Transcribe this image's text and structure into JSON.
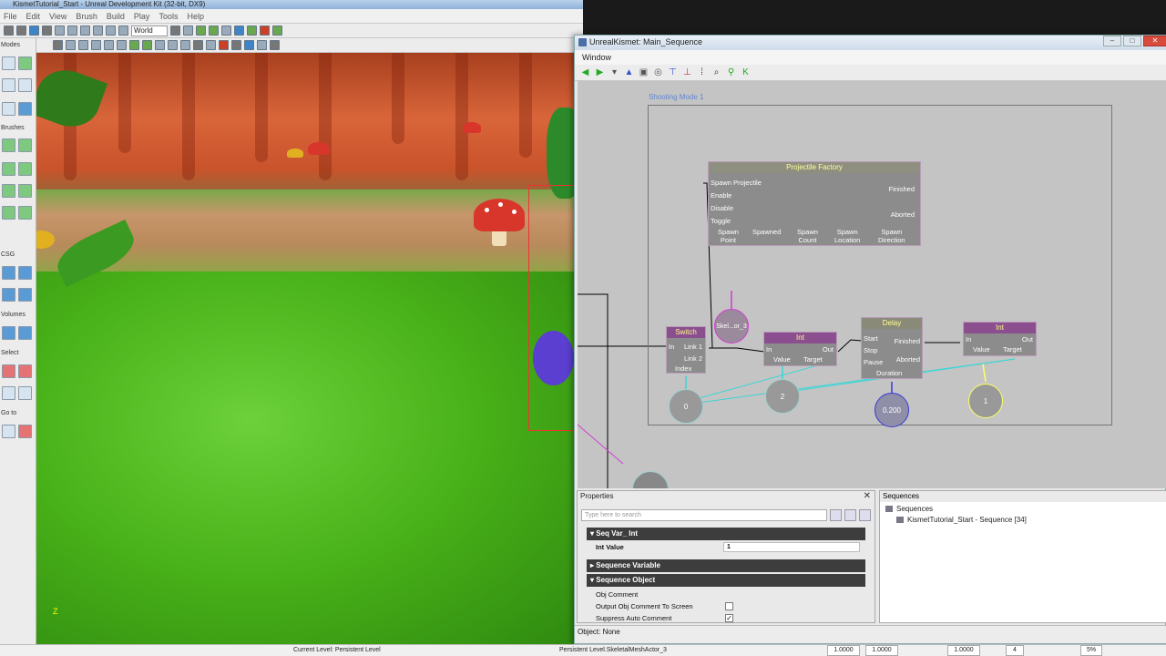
{
  "editor": {
    "title": "KismetTutorial_Start - Unreal Development Kit (32-bit, DX9)",
    "menu": [
      "File",
      "Edit",
      "View",
      "Brush",
      "Build",
      "Play",
      "Tools",
      "Help"
    ],
    "world_select": "World",
    "modes_sections": [
      "Modes",
      "Brushes",
      "CSG",
      "Volumes",
      "Select",
      "Go to"
    ],
    "statusbar": {
      "current_level": "Current Level:  Persistent Level",
      "selected_actor": "Persistent Level.SkeletalMeshActor_3",
      "drag_grid": [
        "1.0000",
        "1.0000",
        "1.0000"
      ],
      "grid_num": "4",
      "percent": "5%"
    }
  },
  "kismet": {
    "title": "UnrealKismet: Main_Sequence",
    "menu": "Window",
    "group_label": "Shooting Mode 1",
    "nodes": {
      "projectile_factory": {
        "title": "Projectile Factory",
        "inputs": [
          "Spawn Projectile",
          "Enable",
          "Disable",
          "Toggle"
        ],
        "outputs": [
          "Finished",
          "Aborted"
        ],
        "vars": [
          "Spawn\nPoint",
          "Spawned",
          "Spawn\nCount",
          "Spawn\nLocation",
          "Spawn\nDirection"
        ]
      },
      "switch": {
        "title": "Switch",
        "in": "In",
        "outs": [
          "Link 1",
          "Link 2"
        ],
        "var": "Index"
      },
      "int1": {
        "title": "Int",
        "in": "In",
        "out": "Out",
        "vars": [
          "Value",
          "Target"
        ]
      },
      "delay": {
        "title": "Delay",
        "inputs": [
          "Start",
          "Stop",
          "Pause"
        ],
        "outputs": [
          "Finished",
          "Aborted"
        ],
        "var": "Duration"
      },
      "int2": {
        "title": "Int",
        "in": "In",
        "out": "Out",
        "vars": [
          "Value",
          "Target"
        ]
      }
    },
    "vars": {
      "skel": "Skel...or_3",
      "v0": "0",
      "v2": "2",
      "v200": "0.200",
      "v1": "1"
    },
    "properties": {
      "title": "Properties",
      "close": "✕",
      "search_placeholder": "Type here to search",
      "cat_seqvar_int": "Seq Var_ Int",
      "int_value_label": "Int Value",
      "int_value": "1",
      "cat_seq_variable": "Sequence Variable",
      "cat_seq_object": "Sequence Object",
      "obj_comment_label": "Obj Comment",
      "output_comment_label": "Output Obj Comment To Screen",
      "suppress_label": "Suppress Auto Comment",
      "suppress_checked": "✓"
    },
    "sequences": {
      "title": "Sequences",
      "root": "Sequences",
      "child": "KismetTutorial_Start - Sequence [34]"
    },
    "status": "Object: None"
  },
  "colors": {
    "action_header": "#8b4f8f",
    "link_pink": "#d23cd2",
    "int_var_cyan": "#38d6d6",
    "float_var_blue": "#3a3ad8",
    "object_var": "#d23cd2"
  }
}
